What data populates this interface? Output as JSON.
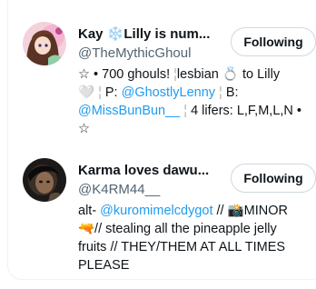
{
  "users": [
    {
      "name": "Kay ❄️Lilly is num...",
      "handle": "@TheMythicGhoul",
      "follow_label": "Following",
      "bio": {
        "l1_a": "☆ • 700 ghouls! ",
        "l1_b": "lesbian ",
        "l1_c": "💍 to Lilly",
        "l2_a": "🤍 ",
        "l2_b": "P: ",
        "l2_link": "@GhostlyLenny",
        "l2_c": "B:",
        "l3_link": "@MissBunBun__",
        "l3_c": "4 lifers: L,F,M,L,N •",
        "l4": "☆"
      }
    },
    {
      "name": "Karma loves dawu...",
      "handle": "@K4RM44__",
      "follow_label": "Following",
      "bio": {
        "l1_a": "alt- ",
        "l1_link": "@kuromimelcdygot",
        "l1_b": " // 📸MINOR",
        "l2": "🔫// stealing all the pineapple jelly",
        "l3": "fruits // THEY/THEM AT ALL TIMES",
        "l4": "PLEASE"
      }
    }
  ]
}
